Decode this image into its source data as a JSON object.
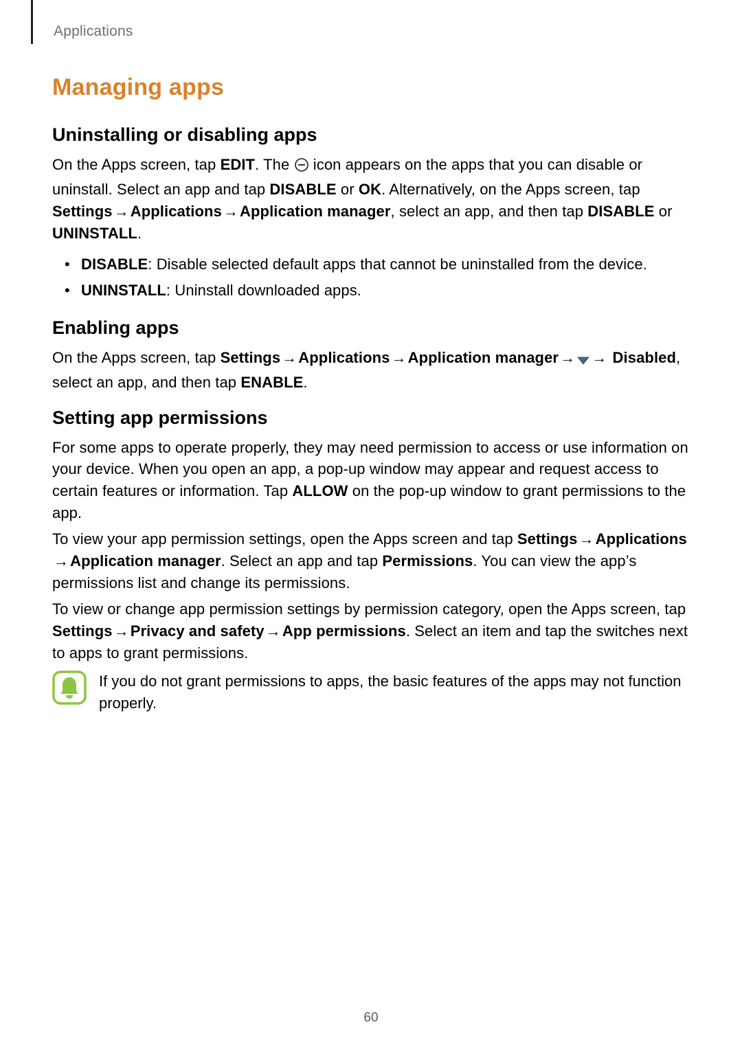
{
  "header": {
    "section": "Applications"
  },
  "title": "Managing apps",
  "sections": {
    "uninstall": {
      "heading": "Uninstalling or disabling apps",
      "p1a": "On the Apps screen, tap ",
      "p1_edit": "EDIT",
      "p1b": ". The ",
      "p1c": " icon appears on the apps that you can disable or uninstall. Select an app and tap ",
      "p1_disable": "DISABLE",
      "p1d": " or ",
      "p1_ok": "OK",
      "p1e": ". Alternatively, on the Apps screen, tap ",
      "p1_settings": "Settings",
      "p1_applications": "Applications",
      "p1_appmanager": "Application manager",
      "p1f": ", select an app, and then tap ",
      "p1_disable2": "DISABLE",
      "p1g": " or ",
      "p1_uninstall": "UNINSTALL",
      "p1h": ".",
      "bullets": [
        {
          "term": "DISABLE",
          "rest": ": Disable selected default apps that cannot be uninstalled from the device."
        },
        {
          "term": "UNINSTALL",
          "rest": ": Uninstall downloaded apps."
        }
      ]
    },
    "enable": {
      "heading": "Enabling apps",
      "p1a": "On the Apps screen, tap ",
      "p1_settings": "Settings",
      "p1_applications": "Applications",
      "p1_appmanager": "Application manager",
      "p1b": " ",
      "p1_disabled": "Disabled",
      "p1c": ", select an app, and then tap ",
      "p1_enable": "ENABLE",
      "p1d": "."
    },
    "perm": {
      "heading": "Setting app permissions",
      "p1a": "For some apps to operate properly, they may need permission to access or use information on your device. When you open an app, a pop-up window may appear and request access to certain features or information. Tap ",
      "p1_allow": "ALLOW",
      "p1b": " on the pop-up window to grant permissions to the app.",
      "p2a": "To view your app permission settings, open the Apps screen and tap ",
      "p2_settings": "Settings",
      "p2_applications": "Applications",
      "p2_appmanager": "Application manager",
      "p2b": ". Select an app and tap ",
      "p2_permissions": "Permissions",
      "p2c": ". You can view the app’s permissions list and change its permissions.",
      "p3a": "To view or change app permission settings by permission category, open the Apps screen, tap ",
      "p3_settings": "Settings",
      "p3_privacy": "Privacy and safety",
      "p3_appperm": "App permissions",
      "p3b": ". Select an item and tap the switches next to apps to grant permissions."
    }
  },
  "note": {
    "text": "If you do not grant permissions to apps, the basic features of the apps may not function properly."
  },
  "arrow_glyph": "→",
  "page_number": "60"
}
